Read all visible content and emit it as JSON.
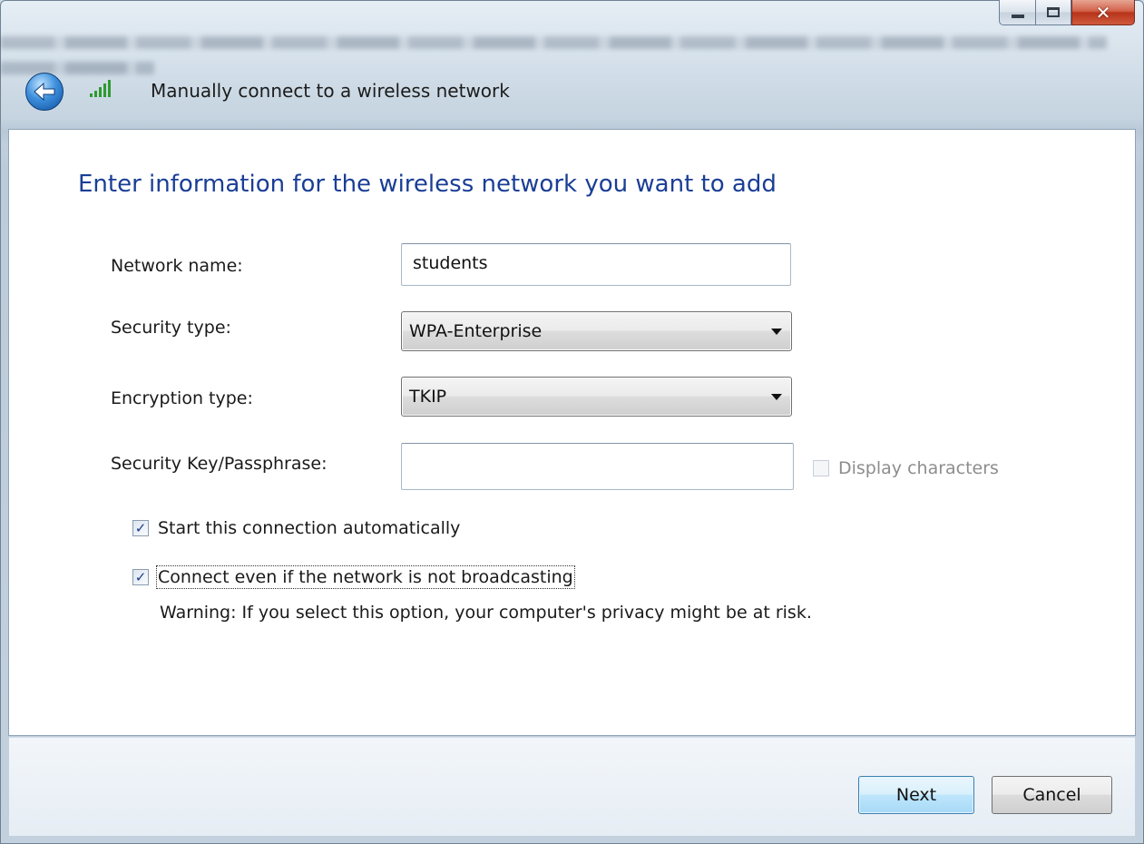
{
  "window": {
    "title": "Manually connect to a wireless network",
    "caption_buttons": {
      "minimize": "minimize-icon",
      "maximize": "maximize-icon",
      "close": "close-icon"
    }
  },
  "page": {
    "heading": "Enter information for the wireless network you want to add"
  },
  "form": {
    "network_name": {
      "label": "Network name:",
      "value": "students"
    },
    "security_type": {
      "label": "Security type:",
      "value": "WPA-Enterprise"
    },
    "encryption_type": {
      "label": "Encryption type:",
      "value": "TKIP"
    },
    "security_key": {
      "label": "Security Key/Passphrase:",
      "value": "",
      "display_characters_label": "Display characters",
      "display_characters_checked": false,
      "display_characters_enabled": false
    },
    "start_automatically": {
      "label": "Start this connection automatically",
      "checked": true
    },
    "connect_hidden": {
      "label": "Connect even if the network is not broadcasting",
      "checked": true
    },
    "warning": "Warning: If you select this option, your computer's privacy might be at risk."
  },
  "buttons": {
    "next": "Next",
    "cancel": "Cancel"
  },
  "colors": {
    "heading": "#1a3e96",
    "default_button_border": "#3c7fb1",
    "close_button": "#c4432a"
  }
}
